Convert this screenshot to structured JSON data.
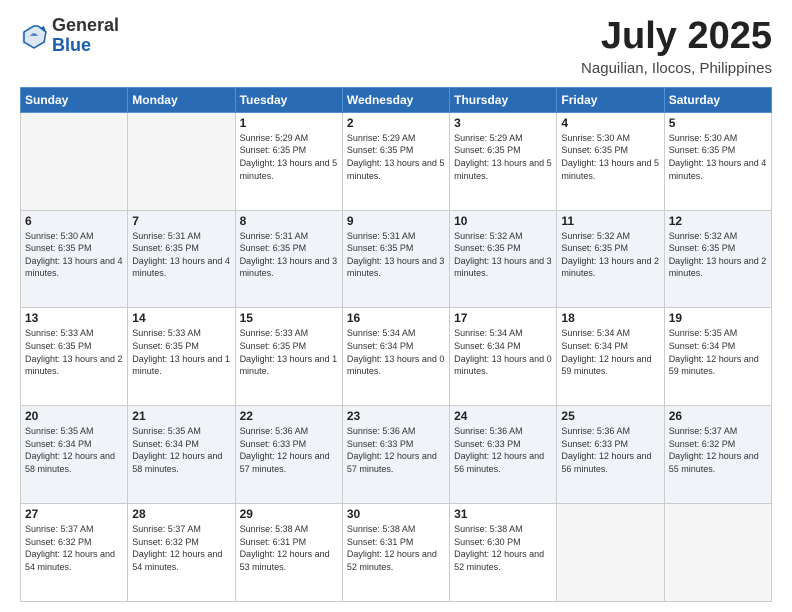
{
  "logo": {
    "general": "General",
    "blue": "Blue"
  },
  "header": {
    "month": "July 2025",
    "location": "Naguilian, Ilocos, Philippines"
  },
  "weekdays": [
    "Sunday",
    "Monday",
    "Tuesday",
    "Wednesday",
    "Thursday",
    "Friday",
    "Saturday"
  ],
  "weeks": [
    [
      {
        "day": "",
        "info": ""
      },
      {
        "day": "",
        "info": ""
      },
      {
        "day": "1",
        "info": "Sunrise: 5:29 AM\nSunset: 6:35 PM\nDaylight: 13 hours and 5 minutes."
      },
      {
        "day": "2",
        "info": "Sunrise: 5:29 AM\nSunset: 6:35 PM\nDaylight: 13 hours and 5 minutes."
      },
      {
        "day": "3",
        "info": "Sunrise: 5:29 AM\nSunset: 6:35 PM\nDaylight: 13 hours and 5 minutes."
      },
      {
        "day": "4",
        "info": "Sunrise: 5:30 AM\nSunset: 6:35 PM\nDaylight: 13 hours and 5 minutes."
      },
      {
        "day": "5",
        "info": "Sunrise: 5:30 AM\nSunset: 6:35 PM\nDaylight: 13 hours and 4 minutes."
      }
    ],
    [
      {
        "day": "6",
        "info": "Sunrise: 5:30 AM\nSunset: 6:35 PM\nDaylight: 13 hours and 4 minutes."
      },
      {
        "day": "7",
        "info": "Sunrise: 5:31 AM\nSunset: 6:35 PM\nDaylight: 13 hours and 4 minutes."
      },
      {
        "day": "8",
        "info": "Sunrise: 5:31 AM\nSunset: 6:35 PM\nDaylight: 13 hours and 3 minutes."
      },
      {
        "day": "9",
        "info": "Sunrise: 5:31 AM\nSunset: 6:35 PM\nDaylight: 13 hours and 3 minutes."
      },
      {
        "day": "10",
        "info": "Sunrise: 5:32 AM\nSunset: 6:35 PM\nDaylight: 13 hours and 3 minutes."
      },
      {
        "day": "11",
        "info": "Sunrise: 5:32 AM\nSunset: 6:35 PM\nDaylight: 13 hours and 2 minutes."
      },
      {
        "day": "12",
        "info": "Sunrise: 5:32 AM\nSunset: 6:35 PM\nDaylight: 13 hours and 2 minutes."
      }
    ],
    [
      {
        "day": "13",
        "info": "Sunrise: 5:33 AM\nSunset: 6:35 PM\nDaylight: 13 hours and 2 minutes."
      },
      {
        "day": "14",
        "info": "Sunrise: 5:33 AM\nSunset: 6:35 PM\nDaylight: 13 hours and 1 minute."
      },
      {
        "day": "15",
        "info": "Sunrise: 5:33 AM\nSunset: 6:35 PM\nDaylight: 13 hours and 1 minute."
      },
      {
        "day": "16",
        "info": "Sunrise: 5:34 AM\nSunset: 6:34 PM\nDaylight: 13 hours and 0 minutes."
      },
      {
        "day": "17",
        "info": "Sunrise: 5:34 AM\nSunset: 6:34 PM\nDaylight: 13 hours and 0 minutes."
      },
      {
        "day": "18",
        "info": "Sunrise: 5:34 AM\nSunset: 6:34 PM\nDaylight: 12 hours and 59 minutes."
      },
      {
        "day": "19",
        "info": "Sunrise: 5:35 AM\nSunset: 6:34 PM\nDaylight: 12 hours and 59 minutes."
      }
    ],
    [
      {
        "day": "20",
        "info": "Sunrise: 5:35 AM\nSunset: 6:34 PM\nDaylight: 12 hours and 58 minutes."
      },
      {
        "day": "21",
        "info": "Sunrise: 5:35 AM\nSunset: 6:34 PM\nDaylight: 12 hours and 58 minutes."
      },
      {
        "day": "22",
        "info": "Sunrise: 5:36 AM\nSunset: 6:33 PM\nDaylight: 12 hours and 57 minutes."
      },
      {
        "day": "23",
        "info": "Sunrise: 5:36 AM\nSunset: 6:33 PM\nDaylight: 12 hours and 57 minutes."
      },
      {
        "day": "24",
        "info": "Sunrise: 5:36 AM\nSunset: 6:33 PM\nDaylight: 12 hours and 56 minutes."
      },
      {
        "day": "25",
        "info": "Sunrise: 5:36 AM\nSunset: 6:33 PM\nDaylight: 12 hours and 56 minutes."
      },
      {
        "day": "26",
        "info": "Sunrise: 5:37 AM\nSunset: 6:32 PM\nDaylight: 12 hours and 55 minutes."
      }
    ],
    [
      {
        "day": "27",
        "info": "Sunrise: 5:37 AM\nSunset: 6:32 PM\nDaylight: 12 hours and 54 minutes."
      },
      {
        "day": "28",
        "info": "Sunrise: 5:37 AM\nSunset: 6:32 PM\nDaylight: 12 hours and 54 minutes."
      },
      {
        "day": "29",
        "info": "Sunrise: 5:38 AM\nSunset: 6:31 PM\nDaylight: 12 hours and 53 minutes."
      },
      {
        "day": "30",
        "info": "Sunrise: 5:38 AM\nSunset: 6:31 PM\nDaylight: 12 hours and 52 minutes."
      },
      {
        "day": "31",
        "info": "Sunrise: 5:38 AM\nSunset: 6:30 PM\nDaylight: 12 hours and 52 minutes."
      },
      {
        "day": "",
        "info": ""
      },
      {
        "day": "",
        "info": ""
      }
    ]
  ]
}
